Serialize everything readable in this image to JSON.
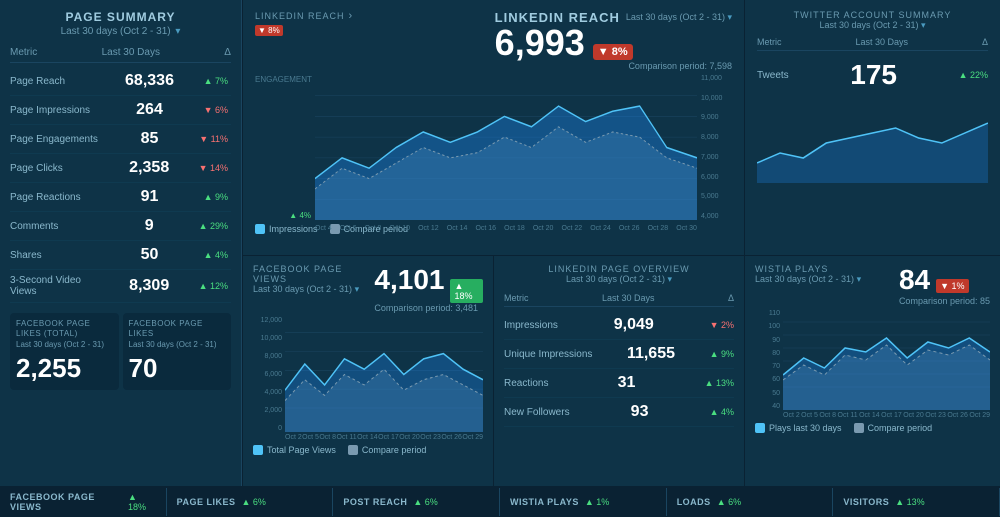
{
  "page_summary": {
    "title": "PAGE SUMMARY",
    "subtitle": "Last 30 days (Oct 2 - 31)",
    "header_metric": "Metric",
    "header_days": "Last 30 Days",
    "header_delta": "Δ",
    "metrics": [
      {
        "name": "Page Reach",
        "value": "68,336",
        "delta": "▲ 7%",
        "up": true
      },
      {
        "name": "Page Impressions",
        "value": "264",
        "delta": "▼ 6%",
        "up": false
      },
      {
        "name": "Page Engagements",
        "value": "85",
        "delta": "▼ 11%",
        "up": false
      },
      {
        "name": "Page Clicks",
        "value": "2,358",
        "delta": "▼ 14%",
        "up": false
      },
      {
        "name": "Page Reactions",
        "value": "91",
        "delta": "▲ 9%",
        "up": true
      },
      {
        "name": "Comments",
        "value": "9",
        "delta": "▲ 29%",
        "up": true
      },
      {
        "name": "Shares",
        "value": "50",
        "delta": "▲ 4%",
        "up": true
      },
      {
        "name": "3-Second Video Views",
        "value": "8,309",
        "delta": "▲ 12%",
        "up": true
      }
    ],
    "bottom_cards": [
      {
        "title": "FACEBOOK PAGE LIKES (TOTAL)",
        "subtitle": "Last 30 days (Oct 2 - 31)",
        "value": "2,255"
      },
      {
        "title": "FACEBOOK PAGE LIKES",
        "subtitle": "Last 30 days (Oct 2 - 31)",
        "value": "70"
      }
    ]
  },
  "linkedin_reach": {
    "label": "LINKEDIN REACH",
    "date_range": "Last 30 days (Oct 2 - 31)",
    "value": "6,993",
    "delta": "▼ 8%",
    "delta_up": false,
    "comparison_label": "Comparison period: 7,598",
    "engagement_label": "ENGAGEMENT",
    "engagement_delta": "▲ 4%",
    "y_labels": [
      "11,000",
      "10,000",
      "9,000",
      "8,000",
      "7,000",
      "6,000",
      "5,000",
      "4,000"
    ],
    "x_labels": [
      "Oct 4",
      "Oct 6",
      "Oct 8",
      "Oct 10",
      "Oct 12",
      "Oct 14",
      "Oct 16",
      "Oct 18",
      "Oct 20",
      "Oct 22",
      "Oct 24",
      "Oct 26",
      "Oct 28",
      "Oct 30"
    ],
    "legend_impressions": "Impressions",
    "legend_compare": "Compare period"
  },
  "twitter_summary": {
    "title": "TWITTER ACCOUNT SUMMARY",
    "date_range": "Last 30 days (Oct 2 - 31)",
    "header_metric": "Metric",
    "header_days": "Last 30 Days",
    "header_delta": "Δ",
    "metrics": [
      {
        "name": "Tweets",
        "value": "175",
        "delta": "▲ 22%",
        "up": true
      }
    ]
  },
  "facebook_views": {
    "title": "FACEBOOK PAGE VIEWS",
    "date_range": "Last 30 days (Oct 2 - 31)",
    "value": "4,101",
    "delta": "▲ 18%",
    "delta_up": true,
    "comparison_label": "Comparison period: 3,481",
    "y_labels": [
      "12,000",
      "10,000",
      "8,000",
      "6,000",
      "4,000",
      "2,000",
      "0"
    ],
    "x_labels": [
      "Oct 2",
      "Oct 5",
      "Oct 8",
      "Oct 11",
      "Oct 14",
      "Oct 17",
      "Oct 20",
      "Oct 23",
      "Oct 26",
      "Oct 29"
    ],
    "legend_total": "Total Page Views",
    "legend_compare": "Compare period"
  },
  "linkedin_overview": {
    "title": "LINKEDIN PAGE OVERVIEW",
    "date_range": "Last 30 days (Oct 2 - 31)",
    "header_metric": "Metric",
    "header_days": "Last 30 Days",
    "header_delta": "Δ",
    "metrics": [
      {
        "name": "Impressions",
        "value": "9,049",
        "delta": "▼ 2%",
        "up": false
      },
      {
        "name": "Unique Impressions",
        "value": "11,655",
        "delta": "▲ 9%",
        "up": true
      },
      {
        "name": "Reactions",
        "value": "31",
        "delta": "▲ 13%",
        "up": true
      },
      {
        "name": "New Followers",
        "value": "93",
        "delta": "▲ 4%",
        "up": true
      }
    ]
  },
  "wistia_plays": {
    "title": "WISTIA PLAYS",
    "date_range": "Last 30 days (Oct 2 - 31)",
    "value": "84",
    "delta": "▼ 1%",
    "delta_up": false,
    "comparison_label": "Comparison period: 85",
    "y_labels": [
      "110",
      "100",
      "90",
      "80",
      "70",
      "60",
      "50",
      "40"
    ],
    "x_labels": [
      "Oct 2",
      "Oct 5",
      "Oct 8",
      "Oct 11",
      "Oct 14",
      "Oct 17",
      "Oct 20",
      "Oct 23",
      "Oct 26",
      "Oct 29"
    ],
    "legend_plays": "Plays last 30 days",
    "legend_compare": "Compare period"
  },
  "bottom_strip": {
    "items": [
      {
        "label": "FACEBOOK PAGE VIEWS",
        "delta": "▲ 18%",
        "up": true
      },
      {
        "label": "PAGE LIKES",
        "delta": "▲ 6%",
        "up": true
      },
      {
        "label": "POST REACH",
        "delta": "▲ 6%",
        "up": true
      },
      {
        "label": "WISTIA PLAYS",
        "delta": "▲ 1%",
        "up": true
      },
      {
        "label": "LOADS",
        "delta": "▲ 6%",
        "up": true
      },
      {
        "label": "VISITORS",
        "delta": "▲ 13%",
        "up": true
      }
    ]
  }
}
